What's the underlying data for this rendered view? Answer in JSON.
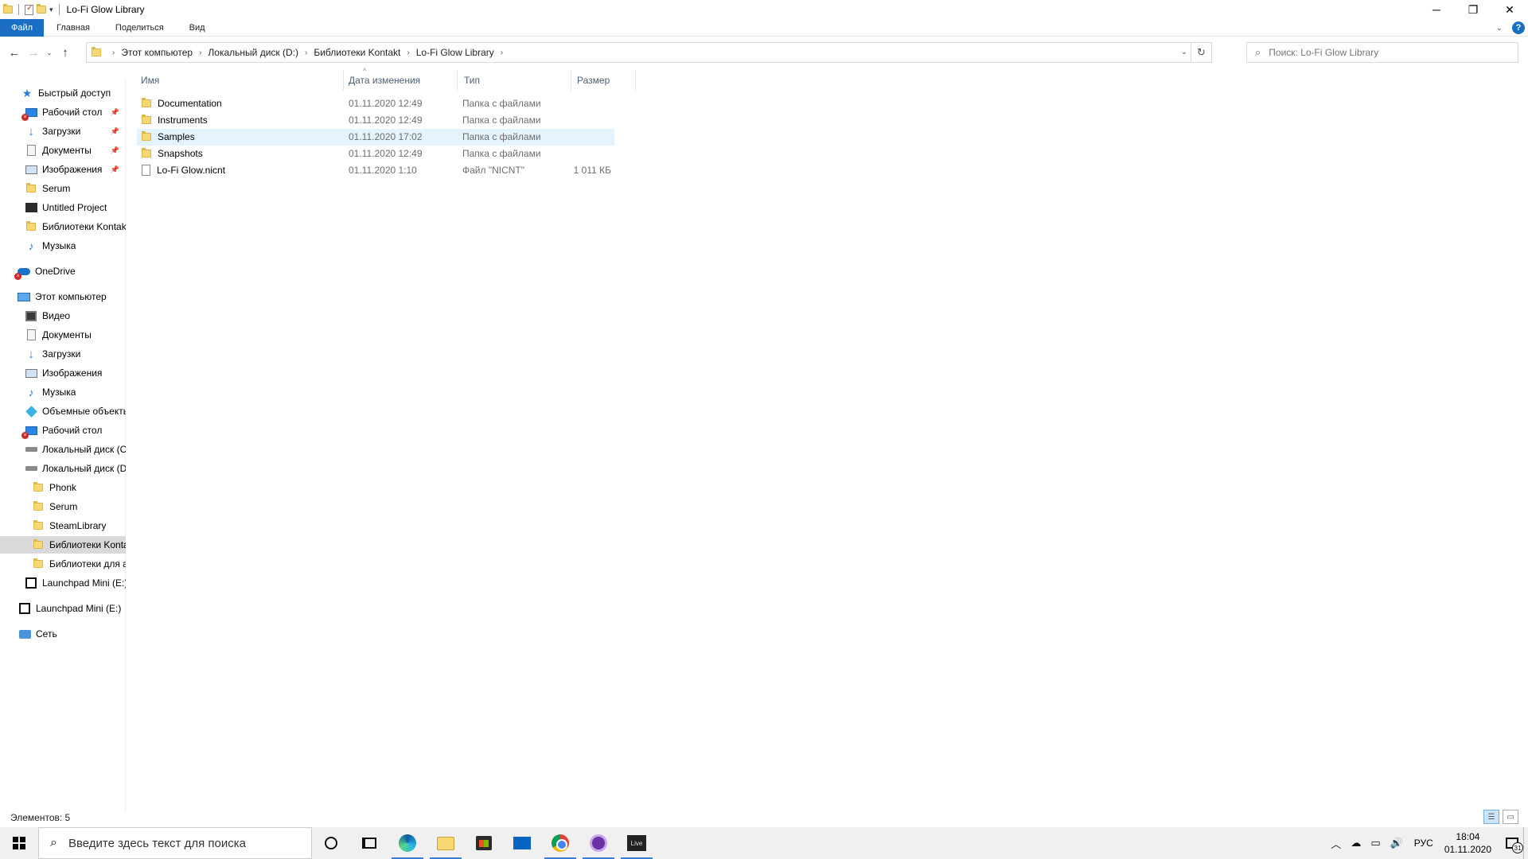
{
  "window": {
    "title": "Lo-Fi Glow Library",
    "controls": {
      "minimize": "─",
      "maximize": "❐",
      "close": "✕"
    }
  },
  "ribbon": {
    "tabs": [
      "Файл",
      "Главная",
      "Поделиться",
      "Вид"
    ],
    "help": "?"
  },
  "address": {
    "breadcrumbs": [
      "Этот компьютер",
      "Локальный диск (D:)",
      "Библиотеки Kontakt",
      "Lo-Fi Glow Library"
    ]
  },
  "search": {
    "placeholder": "Поиск: Lo-Fi Glow Library"
  },
  "sidebar": {
    "items": [
      {
        "label": "Быстрый доступ",
        "icon": "star-icon"
      },
      {
        "label": "Рабочий стол",
        "icon": "desktop-icon",
        "pinned": true,
        "error": true
      },
      {
        "label": "Загрузки",
        "icon": "download-icon",
        "pinned": true
      },
      {
        "label": "Документы",
        "icon": "documents-icon",
        "pinned": true
      },
      {
        "label": "Изображения",
        "icon": "pictures-icon",
        "pinned": true
      },
      {
        "label": "Serum",
        "icon": "folder-icon"
      },
      {
        "label": "Untitled Project",
        "icon": "project-icon"
      },
      {
        "label": "Библиотеки Kontakt",
        "icon": "folder-icon"
      },
      {
        "label": "Музыка",
        "icon": "music-icon"
      },
      {
        "label": "OneDrive",
        "icon": "onedrive-icon",
        "error": true
      },
      {
        "label": "Этот компьютер",
        "icon": "pc-icon"
      },
      {
        "label": "Видео",
        "icon": "video-icon"
      },
      {
        "label": "Документы",
        "icon": "documents-icon"
      },
      {
        "label": "Загрузки",
        "icon": "download-icon"
      },
      {
        "label": "Изображения",
        "icon": "pictures-icon"
      },
      {
        "label": "Музыка",
        "icon": "music-icon"
      },
      {
        "label": "Объемные объекты",
        "icon": "3d-objects-icon"
      },
      {
        "label": "Рабочий стол",
        "icon": "desktop-icon",
        "error": true
      },
      {
        "label": "Локальный диск (C:)",
        "icon": "disk-icon"
      },
      {
        "label": "Локальный диск (D:)",
        "icon": "disk-icon"
      },
      {
        "label": "Phonk",
        "icon": "folder-icon"
      },
      {
        "label": "Serum",
        "icon": "folder-icon"
      },
      {
        "label": "SteamLibrary",
        "icon": "folder-icon"
      },
      {
        "label": "Библиотеки Kontakt",
        "icon": "folder-icon",
        "selected": true
      },
      {
        "label": "Библиотеки для а",
        "icon": "folder-icon"
      },
      {
        "label": "Launchpad Mini (E:)",
        "icon": "launchpad-icon"
      },
      {
        "label": "Launchpad Mini (E:)",
        "icon": "launchpad-icon"
      },
      {
        "label": "Сеть",
        "icon": "network-icon"
      }
    ]
  },
  "columns": {
    "name": "Имя",
    "date": "Дата изменения",
    "type": "Тип",
    "size": "Размер"
  },
  "files": [
    {
      "name": "Documentation",
      "date": "01.11.2020 12:49",
      "type": "Папка с файлами",
      "size": "",
      "kind": "folder"
    },
    {
      "name": "Instruments",
      "date": "01.11.2020 12:49",
      "type": "Папка с файлами",
      "size": "",
      "kind": "folder"
    },
    {
      "name": "Samples",
      "date": "01.11.2020 17:02",
      "type": "Папка с файлами",
      "size": "",
      "kind": "folder",
      "selected": true
    },
    {
      "name": "Snapshots",
      "date": "01.11.2020 12:49",
      "type": "Папка с файлами",
      "size": "",
      "kind": "folder"
    },
    {
      "name": "Lo-Fi Glow.nicnt",
      "date": "01.11.2020 1:10",
      "type": "Файл \"NICNT\"",
      "size": "1 011 КБ",
      "kind": "file"
    }
  ],
  "status": {
    "items": "Элементов: 5"
  },
  "taskbar": {
    "search_placeholder": "Введите здесь текст для поиска",
    "apps": [
      "cortana-icon",
      "task-view-icon",
      "edge-icon",
      "file-explorer-icon",
      "store-icon",
      "mail-icon",
      "chrome-icon",
      "tor-icon",
      "ableton-live-icon"
    ],
    "live_label": "Live",
    "lang": "РУС",
    "time": "18:04",
    "date": "01.11.2020",
    "notifications": "31"
  },
  "colors": {
    "accent": "#1a6fc4",
    "selected_row": "#e5f3ff",
    "folder": "#f8d775"
  }
}
